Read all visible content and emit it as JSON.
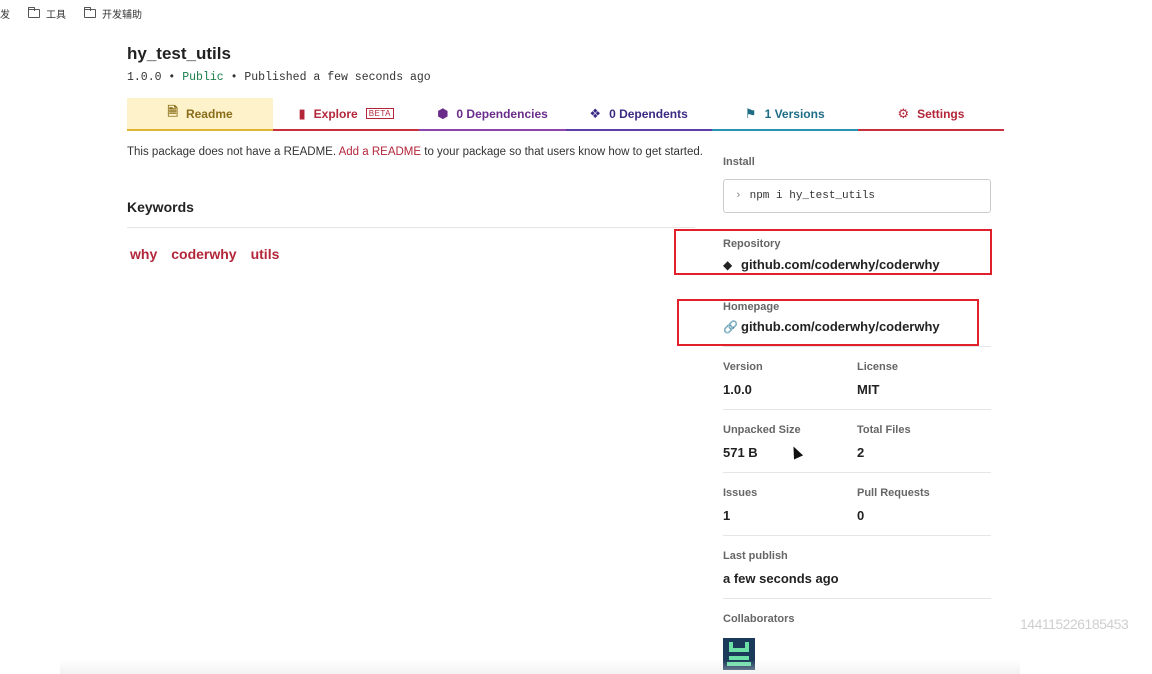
{
  "bookmarks": [
    {
      "label": "发"
    },
    {
      "label": "工具"
    },
    {
      "label": "开发辅助"
    }
  ],
  "package": {
    "name": "hy_test_utils",
    "version": "1.0.0",
    "visibility": "Public",
    "published": "Published a few seconds ago",
    "separator": "•"
  },
  "tabs": [
    {
      "label": "Readme",
      "icon": "file-icon"
    },
    {
      "label": "Explore",
      "icon": "file-code-icon",
      "badge": "BETA"
    },
    {
      "label": "0 Dependencies",
      "icon": "box-icon"
    },
    {
      "label": "0 Dependents",
      "icon": "boxes-icon"
    },
    {
      "label": "1 Versions",
      "icon": "tag-icon"
    },
    {
      "label": "Settings",
      "icon": "gear-icon"
    }
  ],
  "readme": {
    "message_before": "This package does not have a README.",
    "link_label": "Add a README",
    "message_after": "to your package so that users know how to get started."
  },
  "keywords": {
    "title": "Keywords",
    "items": [
      "why",
      "coderwhy",
      "utils"
    ]
  },
  "sidebar": {
    "install_label": "Install",
    "install_command": "npm i hy_test_utils",
    "repository_label": "Repository",
    "repository_value": "github.com/coderwhy/coderwhy",
    "homepage_label": "Homepage",
    "homepage_value": "github.com/coderwhy/coderwhy",
    "version_label": "Version",
    "version_value": "1.0.0",
    "license_label": "License",
    "license_value": "MIT",
    "unpacked_label": "Unpacked Size",
    "unpacked_value": "571 B",
    "total_files_label": "Total Files",
    "total_files_value": "2",
    "issues_label": "Issues",
    "issues_value": "1",
    "pulls_label": "Pull Requests",
    "pulls_value": "0",
    "last_publish_label": "Last publish",
    "last_publish_value": "a few seconds ago",
    "collaborators_label": "Collaborators"
  },
  "watermark": "144115226185453",
  "colors": {
    "accent_red": "#b3263a",
    "public_green": "#1a7f4b",
    "highlight_box": "#e0202a"
  }
}
